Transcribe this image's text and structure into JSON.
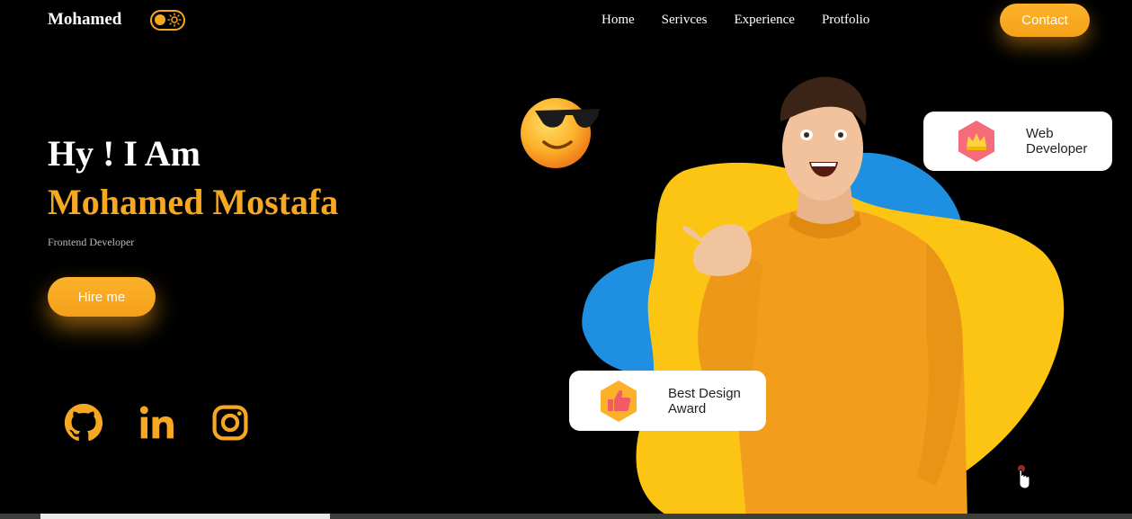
{
  "nav": {
    "brand": "Mohamed",
    "theme_toggle_icon": "sun-icon",
    "links": [
      "Home",
      "Serivces",
      "Experience",
      "Protfolio"
    ],
    "contact_label": "Contact"
  },
  "hero": {
    "greeting": "Hy ! I Am",
    "name": "Mohamed Mostafa",
    "role": "Frontend Developer",
    "hire_label": "Hire me"
  },
  "social": [
    {
      "icon": "github-icon"
    },
    {
      "icon": "linkedin-icon"
    },
    {
      "icon": "instagram-icon"
    }
  ],
  "cards": {
    "web": {
      "label": "Web\nDeveloper",
      "icon": "crown-icon"
    },
    "award": {
      "label": "Best Design\nAward",
      "icon": "thumbs-up-icon"
    }
  },
  "colors": {
    "accent": "#f7a823",
    "blob_yellow": "#fcc413",
    "blob_blue": "#1e8fe1",
    "background": "#000000"
  }
}
